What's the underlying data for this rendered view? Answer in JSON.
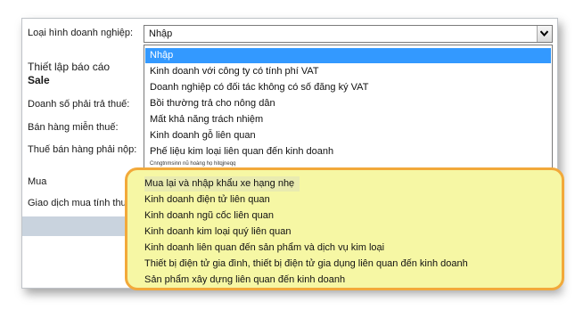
{
  "form": {
    "business_type_label": "Loại hình doanh nghiệp:",
    "section_title": "Thiết lập báo cáo",
    "section_subtitle": "Sale",
    "fields": [
      "Doanh số phải trả thuế:",
      "Bán hàng miễn thuế:",
      "Thuế bán hàng phải nộp:",
      "Mua",
      "Giao dịch mua tính thuế:"
    ]
  },
  "combo": {
    "selected": "Nhập"
  },
  "dropdown": {
    "options": [
      "Nhập",
      "Kinh doanh với công ty có tính phí VAT",
      "Doanh nghiệp có đối tác không có số đăng ký VAT",
      "Bồi thường trả cho nông dân",
      "Mất khả năng trách nhiệm",
      "Kinh doanh gỗ liên quan",
      "Phế liệu kim loại liên quan đến kinh doanh"
    ],
    "tiny_option": "Cnngtnmsinn nũ hoàng họ hitqjneqq",
    "highlighted_options": [
      "Mua lại và nhập khẩu xe hạng nhẹ",
      "Kinh doanh điện tử liên quan",
      "Kinh doanh ngũ cốc liên quan",
      "Kinh doanh kim loại quý liên quan",
      "Kinh doanh liên quan đến sản phẩm và dịch vụ kim loại",
      "Thiết bị điện tử gia đình, thiết bị điện tử gia dụng liên quan đến kinh doanh",
      "Sản phẩm xây dựng liên quan đến kinh doanh"
    ]
  },
  "colors": {
    "selection": "#3399ff",
    "highlight_fill": "#f6f7a4",
    "highlight_border": "#f2a93a"
  }
}
